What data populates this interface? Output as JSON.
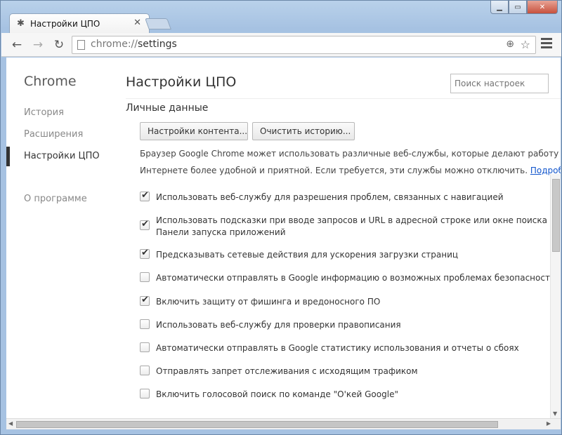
{
  "tab": {
    "title": "Настройки ЦПО",
    "icon": "gear-icon",
    "close": "✕"
  },
  "window_controls": {
    "minimize": "▁",
    "maximize": "▭",
    "close": "✕"
  },
  "toolbar": {
    "back": "←",
    "forward": "→",
    "reload": "↻",
    "url_scheme": "chrome://",
    "url_path": "settings",
    "zoom": "⊕",
    "star": "☆"
  },
  "sidebar": {
    "title": "Chrome",
    "items": [
      {
        "label": "История"
      },
      {
        "label": "Расширения"
      },
      {
        "label": "Настройки ЦПО"
      },
      {
        "label": "О программе"
      }
    ]
  },
  "main": {
    "title": "Настройки ЦПО",
    "search_placeholder": "Поиск настроек",
    "section_title": "Личные данные",
    "btn_content": "Настройки контента...",
    "btn_clear": "Очистить историю...",
    "desc_line1": "Браузер Google Chrome может использовать различные веб-службы, которые делают работу в",
    "desc_line2": "Интернете более удобной и приятной. Если требуется, эти службы можно отключить.",
    "desc_link": "Подробн",
    "options": [
      {
        "label": "Использовать веб-службу для разрешения проблем, связанных с навигацией",
        "checked": true
      },
      {
        "label": "Использовать подсказки при вводе запросов и URL в адресной строке или окне поиска на",
        "label2": "Панели запуска приложений",
        "checked": true
      },
      {
        "label": "Предсказывать сетевые действия для ускорения загрузки страниц",
        "checked": true
      },
      {
        "label": "Автоматически отправлять в Google информацию о возможных проблемах безопасности",
        "checked": false
      },
      {
        "label": "Включить защиту от фишинга и вредоносного ПО",
        "checked": true
      },
      {
        "label": "Использовать веб-службу для проверки правописания",
        "checked": false
      },
      {
        "label": "Автоматически отправлять в Google статистику использования и отчеты о сбоях",
        "checked": false
      },
      {
        "label": "Отправлять запрет отслеживания с исходящим трафиком",
        "checked": false
      },
      {
        "label": "Включить голосовой поиск по команде \"О'кей Google\"",
        "checked": false
      }
    ]
  },
  "scroll": {
    "up": "▲",
    "down": "▼",
    "left": "◀",
    "right": "▶"
  }
}
